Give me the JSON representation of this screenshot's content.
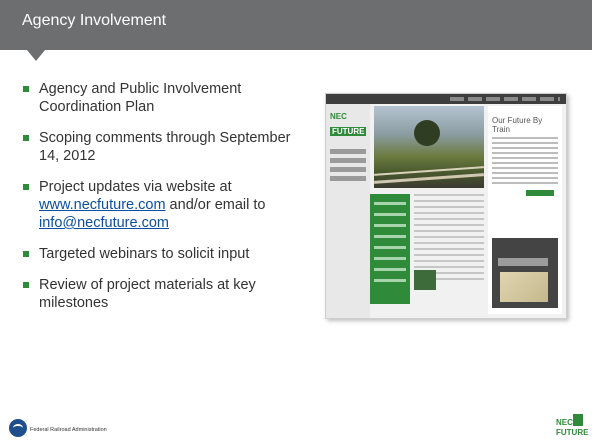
{
  "header": {
    "title": "Agency Involvement"
  },
  "bullets": [
    {
      "text": "Agency and Public Involvement Coordination Plan"
    },
    {
      "text": "Scoping comments through September 14, 2012"
    },
    {
      "text_before": "Project updates via website at ",
      "link1": "www.necfuture.com",
      "text_middle": " and/or email to ",
      "link2": "info@necfuture.com"
    },
    {
      "text": "Targeted webinars to solicit input"
    },
    {
      "text": "Review of project materials at key milestones"
    }
  ],
  "screenshot": {
    "logo_top": "NEC",
    "logo_bottom": "FUTURE",
    "side_heading": "Our Future By Train"
  },
  "footer": {
    "agency": "Federal Railroad Administration"
  },
  "corner_logo": {
    "top": "NEC",
    "bottom": "FUTURE"
  },
  "colors": {
    "header": "#6d6e70",
    "accent": "#2f8a3a",
    "link": "#0b4ea2"
  }
}
